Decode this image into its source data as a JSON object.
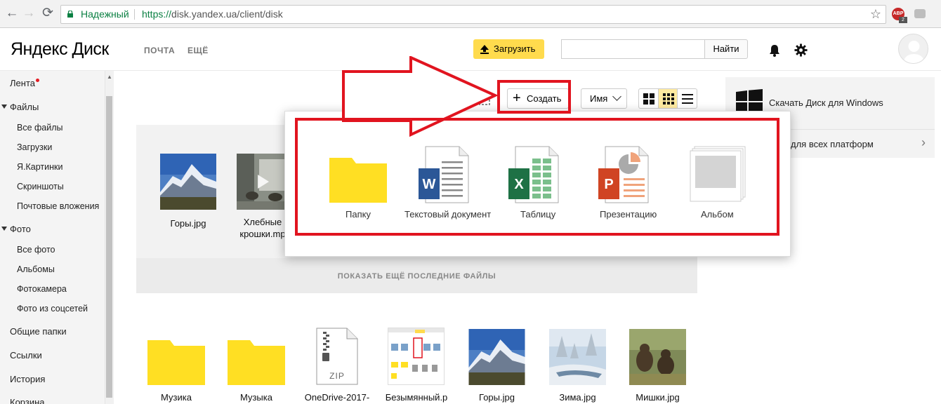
{
  "browser": {
    "secure_label": "Надежный",
    "url_scheme": "https://",
    "url_rest": "disk.yandex.ua/client/disk",
    "ext_label": "ABP",
    "ext_badge": "2"
  },
  "header": {
    "logo_ya": "Яндекс",
    "logo_disk": "Диск",
    "nav": [
      "ПОЧТА",
      "ЕЩЁ"
    ],
    "upload_label": "Загрузить",
    "search_button": "Найти",
    "search_placeholder": ""
  },
  "sidebar": {
    "feed": "Лента",
    "files": "Файлы",
    "files_items": [
      "Все файлы",
      "Загрузки",
      "Я.Картинки",
      "Скриншоты",
      "Почтовые вложения"
    ],
    "photo": "Фото",
    "photo_items": [
      "Все фото",
      "Альбомы",
      "Фотокамера",
      "Фото из соцсетей"
    ],
    "others": [
      "Общие папки",
      "Ссылки",
      "История",
      "Корзина"
    ]
  },
  "toolbar": {
    "create_label": "Создать",
    "sort_label": "Имя"
  },
  "recent": {
    "items": [
      "Горы.jpg",
      "Хлебные крошки.mp"
    ],
    "show_more": "ПОКАЗАТЬ ЕЩЁ ПОСЛЕДНИЕ ФАЙЛЫ"
  },
  "files": [
    "Музика",
    "Музыка",
    "OneDrive-2017-",
    "Безымянный.р",
    "Горы.jpg",
    "Зима.jpg",
    "Мишки.jpg"
  ],
  "files_zip_label": "ZIP",
  "promo": {
    "windows": "Скачать Диск для Windows",
    "all_platforms": "для всех платформ"
  },
  "create_menu": {
    "items": [
      "Папку",
      "Текстовый документ",
      "Таблицу",
      "Презентацию",
      "Альбом"
    ]
  },
  "colors": {
    "accent_yellow": "#ffdb4d",
    "annotation_red": "#e1141f",
    "folder_yellow": "#ffdf23"
  }
}
